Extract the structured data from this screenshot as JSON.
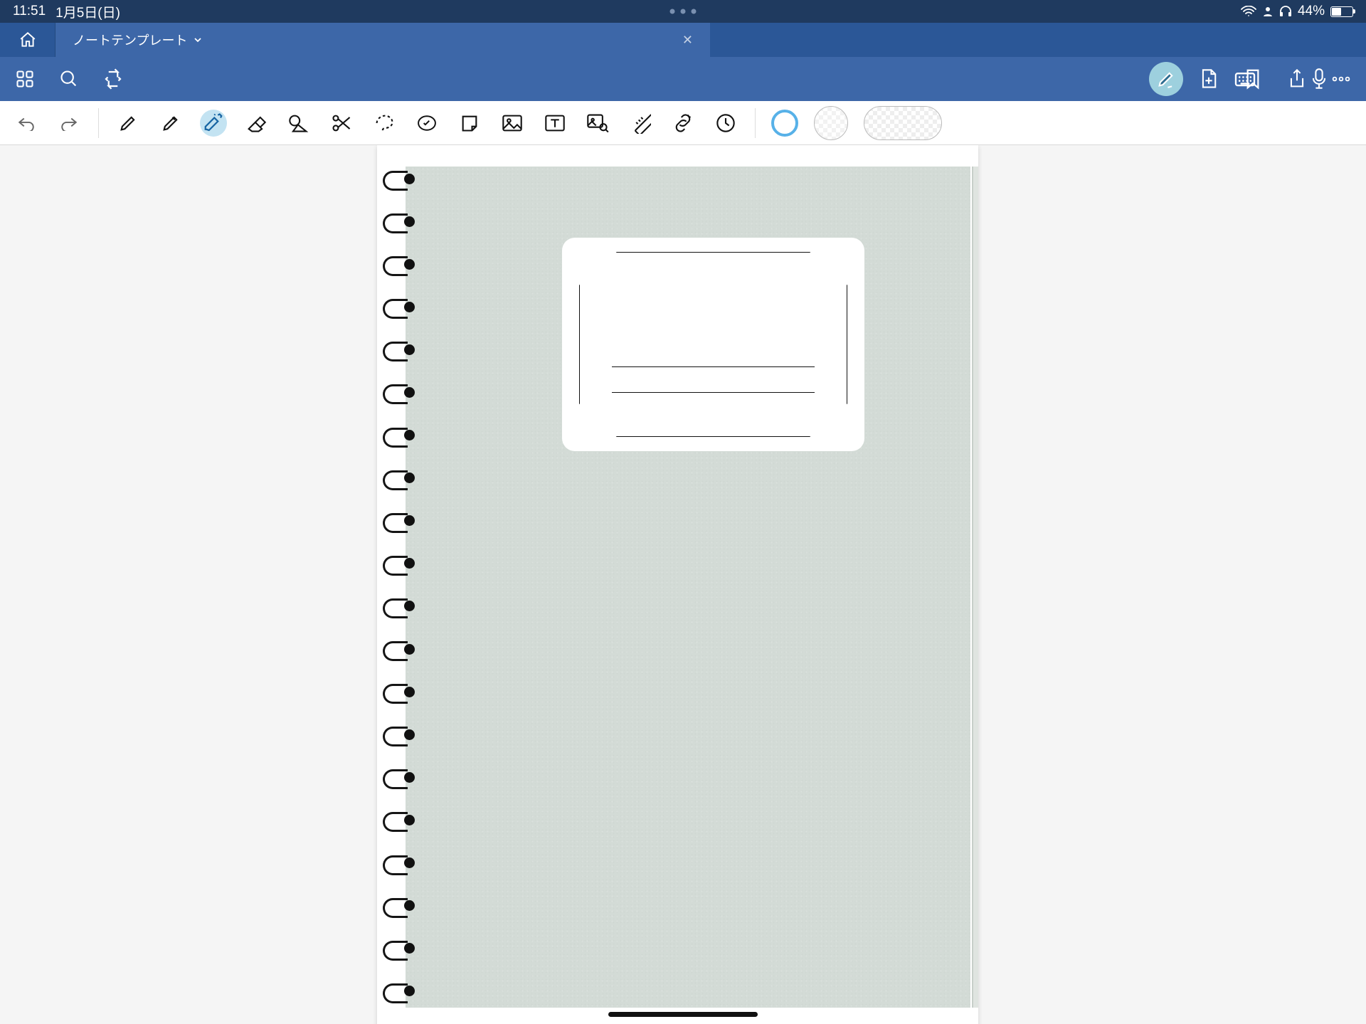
{
  "status": {
    "time": "11:51",
    "date": "1月5日(日)",
    "battery_pct": "44%"
  },
  "tab": {
    "title": "ノートテンプレート"
  },
  "swatches": {
    "active": "#57b1e8"
  },
  "notebook": {
    "cover_color": "#d3dbd6",
    "ring_count": 20
  }
}
